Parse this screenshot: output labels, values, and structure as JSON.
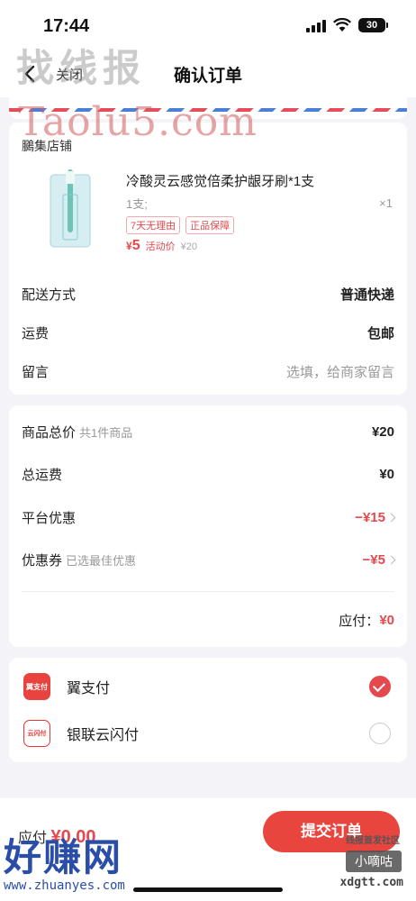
{
  "status": {
    "time": "17:44",
    "battery": "30"
  },
  "nav": {
    "close": "关闭",
    "title": "确认订单"
  },
  "watermarks": {
    "top": "找线报",
    "taolu": "Taolu5.com",
    "bottom_big": "好赚网",
    "bottom_url": "www.zhuanyes.com",
    "br_line1": "线报首发社区",
    "br_line2": "小嘀咕",
    "br_line3": "xdgtt.com"
  },
  "shop": {
    "name": "鵩集店铺",
    "product": {
      "title": "冷酸灵云感觉倍柔护龈牙刷*1支",
      "spec": "1支;",
      "qty": "×1",
      "tags": [
        "7天无理由",
        "正品保障"
      ],
      "price_symbol": "¥",
      "price": "5",
      "price_tag": "活动价",
      "original_price": "¥20"
    },
    "delivery": {
      "label": "配送方式",
      "value": "普通快递"
    },
    "shipping": {
      "label": "运费",
      "value": "包邮"
    },
    "message": {
      "label": "留言",
      "placeholder": "选填，给商家留言"
    }
  },
  "summary": {
    "total": {
      "label": "商品总价",
      "sub": "共1件商品",
      "value": "¥20"
    },
    "freight": {
      "label": "总运费",
      "value": "¥0"
    },
    "platform_discount": {
      "label": "平台优惠",
      "value": "−¥15"
    },
    "coupon": {
      "label": "优惠券",
      "sub": "已选最佳优惠",
      "value": "−¥5"
    },
    "due": {
      "label": "应付：",
      "value": "¥0"
    }
  },
  "payment": {
    "methods": [
      {
        "name": "翼支付",
        "icon": "翼支付",
        "selected": true
      },
      {
        "name": "银联云闪付",
        "icon": "云闪付",
        "selected": false
      }
    ]
  },
  "footer": {
    "due_label": "应付",
    "due_value": "¥0.00",
    "submit": "提交订单"
  },
  "colors": {
    "accent": "#e5484d",
    "button": "#e8453f"
  }
}
